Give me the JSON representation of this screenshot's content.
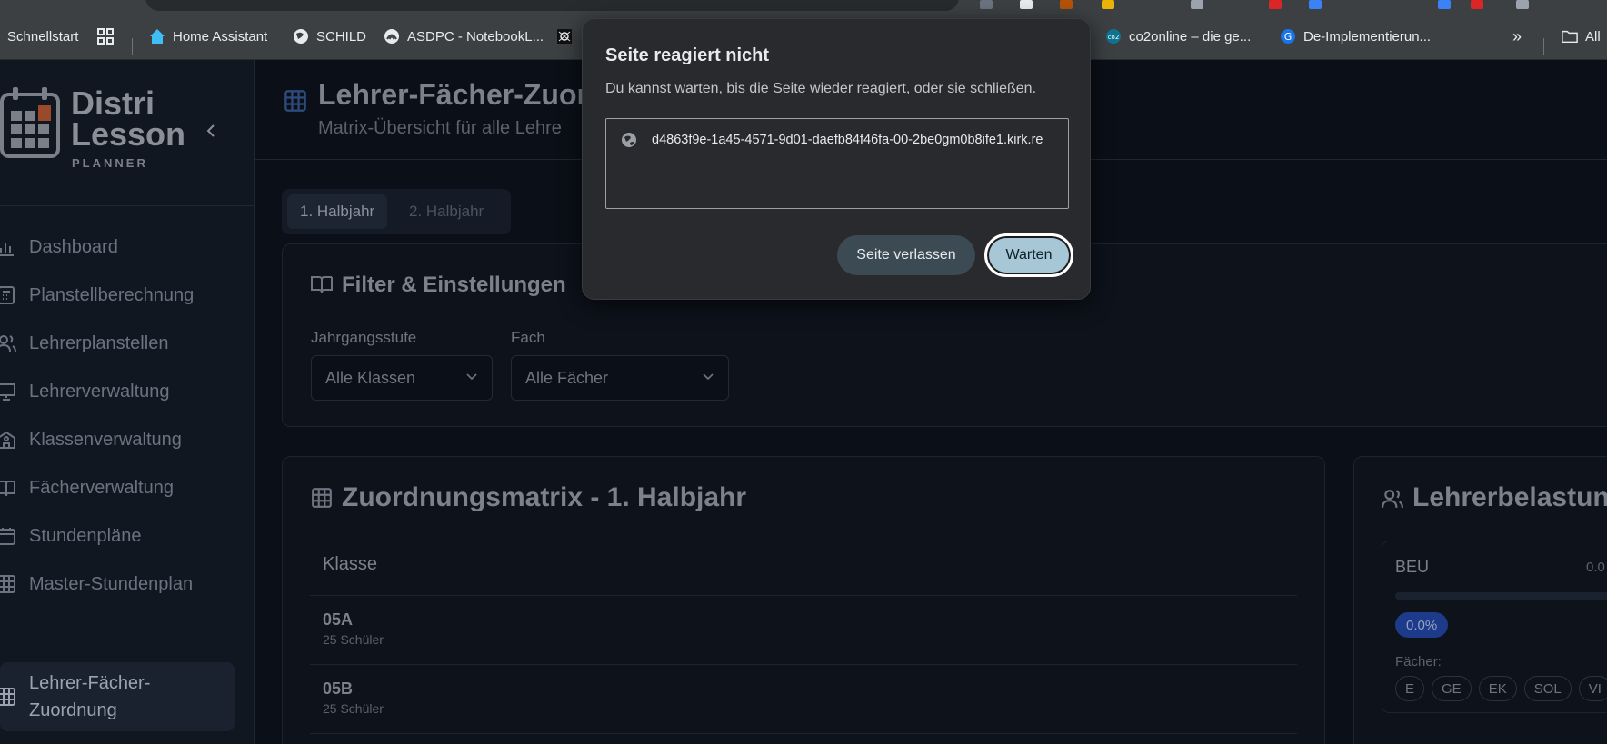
{
  "bookmarks": {
    "items": [
      {
        "label": "Schnellstart"
      },
      {
        "label": "Home Assistant"
      },
      {
        "label": "SCHILD"
      },
      {
        "label": "ASDPC - NotebookL..."
      },
      {
        "label": "co2online – die ge..."
      },
      {
        "label": "De-Implementierun..."
      },
      {
        "label": "All"
      }
    ],
    "overflow": "»"
  },
  "sidebar": {
    "logo_line1": "Distri",
    "logo_line2": "Lesson",
    "logo_line3": "PLANNER",
    "items": [
      {
        "label": "Dashboard",
        "icon": "bar-chart-icon"
      },
      {
        "label": "Planstellberechnung",
        "icon": "calculator-icon"
      },
      {
        "label": "Lehrerplanstellen",
        "icon": "users-icon"
      },
      {
        "label": "Lehrerverwaltung",
        "icon": "presentation-icon"
      },
      {
        "label": "Klassenverwaltung",
        "icon": "school-icon"
      },
      {
        "label": "Fächerverwaltung",
        "icon": "book-icon"
      },
      {
        "label": "Stundenpläne",
        "icon": "calendar-icon"
      },
      {
        "label": "Master-Stundenplan",
        "icon": "grid-icon"
      },
      {
        "label": "Lehrer-Fächer-Zuordnung",
        "line1": "Lehrer-Fächer-",
        "line2": "Zuordnung",
        "icon": "grid-icon",
        "active": true
      }
    ]
  },
  "header": {
    "title": "Lehrer-Fächer-Zuor",
    "subtitle": "Matrix-Übersicht für alle Lehre"
  },
  "tabs": [
    {
      "label": "1. Halbjahr",
      "active": true
    },
    {
      "label": "2. Halbjahr",
      "active": false
    }
  ],
  "filters": {
    "title": "Filter & Einstellungen",
    "grade_label": "Jahrgangsstufe",
    "grade_value": "Alle Klassen",
    "subject_label": "Fach",
    "subject_value": "Alle Fächer"
  },
  "matrix": {
    "title": "Zuordnungsmatrix - 1. Halbjahr",
    "column_header": "Klasse",
    "rows": [
      {
        "name": "05A",
        "students": "25 Schüler"
      },
      {
        "name": "05B",
        "students": "25 Schüler"
      }
    ]
  },
  "workload": {
    "title": "Lehrerbelastung",
    "teacher": "BEU",
    "value": "0.0",
    "percent": "0.0%",
    "subjects_label": "Fächer:",
    "subjects": [
      "E",
      "GE",
      "EK",
      "SOL",
      "VI"
    ]
  },
  "dialog": {
    "title": "Seite reagiert nicht",
    "message": "Du kannst warten, bis die Seite wieder reagiert, oder sie schließen.",
    "url": "d4863f9e-1a45-4571-9d01-daefb84f46fa-00-2be0gm0b8ife1.kirk.re",
    "leave_label": "Seite verlassen",
    "wait_label": "Warten"
  },
  "colors": {
    "accent": "#a8c7d6",
    "badge_blue": "#1e3a8a"
  }
}
